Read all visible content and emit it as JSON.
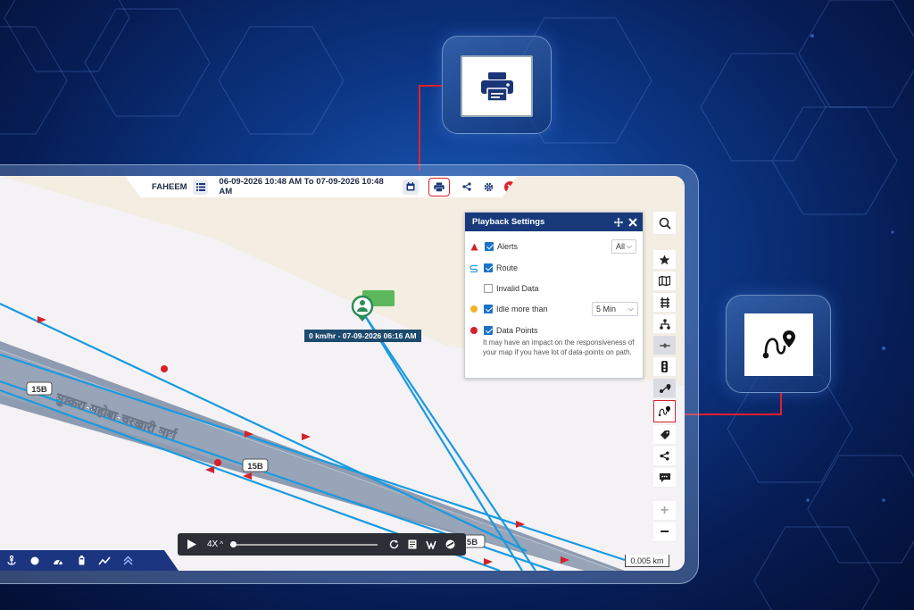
{
  "topbar": {
    "vehicle": "FAHEEM",
    "date_range": "06-09-2026 10:48 AM To 07-09-2026 10:48 AM"
  },
  "map": {
    "speed_label": "0 km/hr - 07-09-2026 06:16 AM",
    "road_name": "मुस्करा-महोबा-चरखारी मार्ग",
    "road_badge_1": "15B",
    "road_badge_2": "15B",
    "road_badge_3": "5B",
    "scale": "0.005 km"
  },
  "panel": {
    "title": "Playback Settings",
    "alerts_label": "Alerts",
    "alerts_option": "All",
    "route_label": "Route",
    "invalid_label": "Invalid Data",
    "idle_label": "Idle more than",
    "idle_option": "5 Min",
    "datapoints_label": "Data Points",
    "datapoints_note": "It may have an impact on the responsiveness of your map if you have lot of data-points on path."
  },
  "player": {
    "speed": "4X",
    "progress": 0.02
  },
  "colors": {
    "primary": "#183a7b",
    "accent_red": "#d6202a",
    "route_blue": "#1a9ae0",
    "road_grey": "#8e9bb0"
  },
  "icons": [
    "printer-icon",
    "route-pin-icon",
    "search-icon",
    "star-icon",
    "map-icon",
    "railway-icon",
    "network-icon",
    "traffic-icon",
    "share-icon",
    "tag-icon",
    "sos-icon",
    "gear-icon",
    "close-icon"
  ]
}
